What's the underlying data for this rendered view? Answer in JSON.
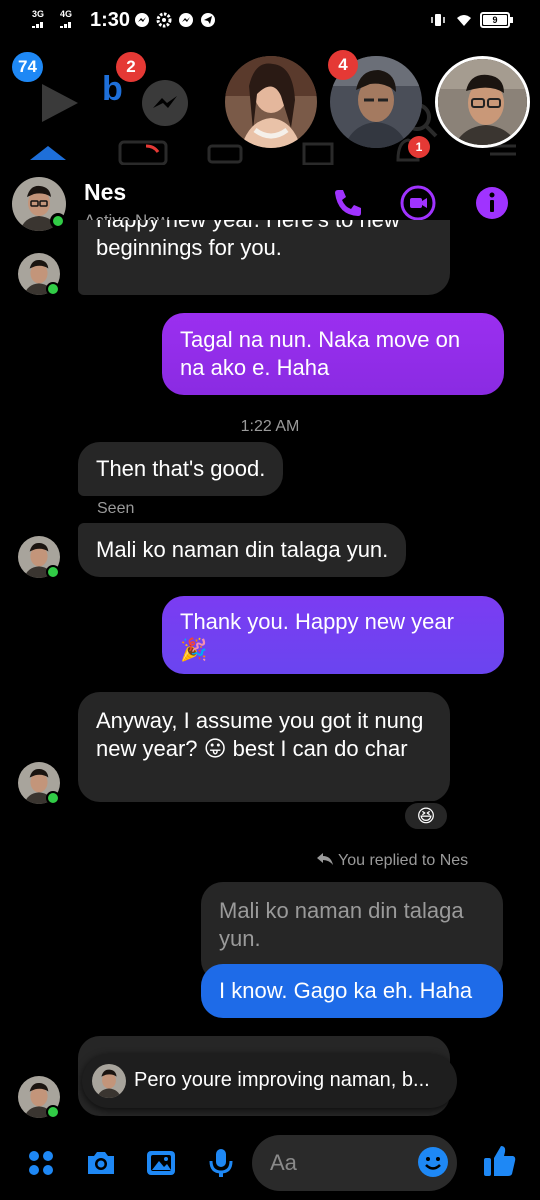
{
  "status_bar": {
    "net1": "3G",
    "net2": "4G",
    "time": "1:30",
    "battery": "9"
  },
  "notifications": {
    "badge_apps": "74",
    "badge_b": "2",
    "badge_chat_head": "4",
    "badge_small": "1"
  },
  "header": {
    "name": "Nes",
    "status": "Active Now",
    "accent_color": "#a033ff"
  },
  "messages": [
    {
      "dir": "in",
      "text": "beginnings for you.",
      "clipped_text": "Happy new year. Here's to new"
    },
    {
      "dir": "out",
      "text": "Tagal na nun. Naka move on na ako e. Haha"
    },
    {
      "type": "time",
      "text": "1:22 AM"
    },
    {
      "dir": "in",
      "text": "Then that's good."
    },
    {
      "type": "seen",
      "text": "Seen"
    },
    {
      "dir": "in",
      "text": "Mali ko naman din talaga yun."
    },
    {
      "dir": "out",
      "text": "Thank you. Happy new year 🎉"
    },
    {
      "dir": "in",
      "text": "Anyway, I assume you got it nung new year? 😛 best I can do char",
      "reaction": "😆"
    },
    {
      "type": "reply_label",
      "text": "You replied to Nes"
    },
    {
      "type": "quoted",
      "text": "Mali ko naman din talaga yun."
    },
    {
      "dir": "out",
      "text": "I know. Gago ka eh. Haha"
    }
  ],
  "toast": {
    "text": "Pero youre improving naman, b..."
  },
  "composer": {
    "placeholder": "Aa"
  },
  "colors": {
    "bubble_out": "#8a2be2",
    "bubble_in": "#262626",
    "online": "#31cc46",
    "messenger_blue": "#1e88f5"
  }
}
